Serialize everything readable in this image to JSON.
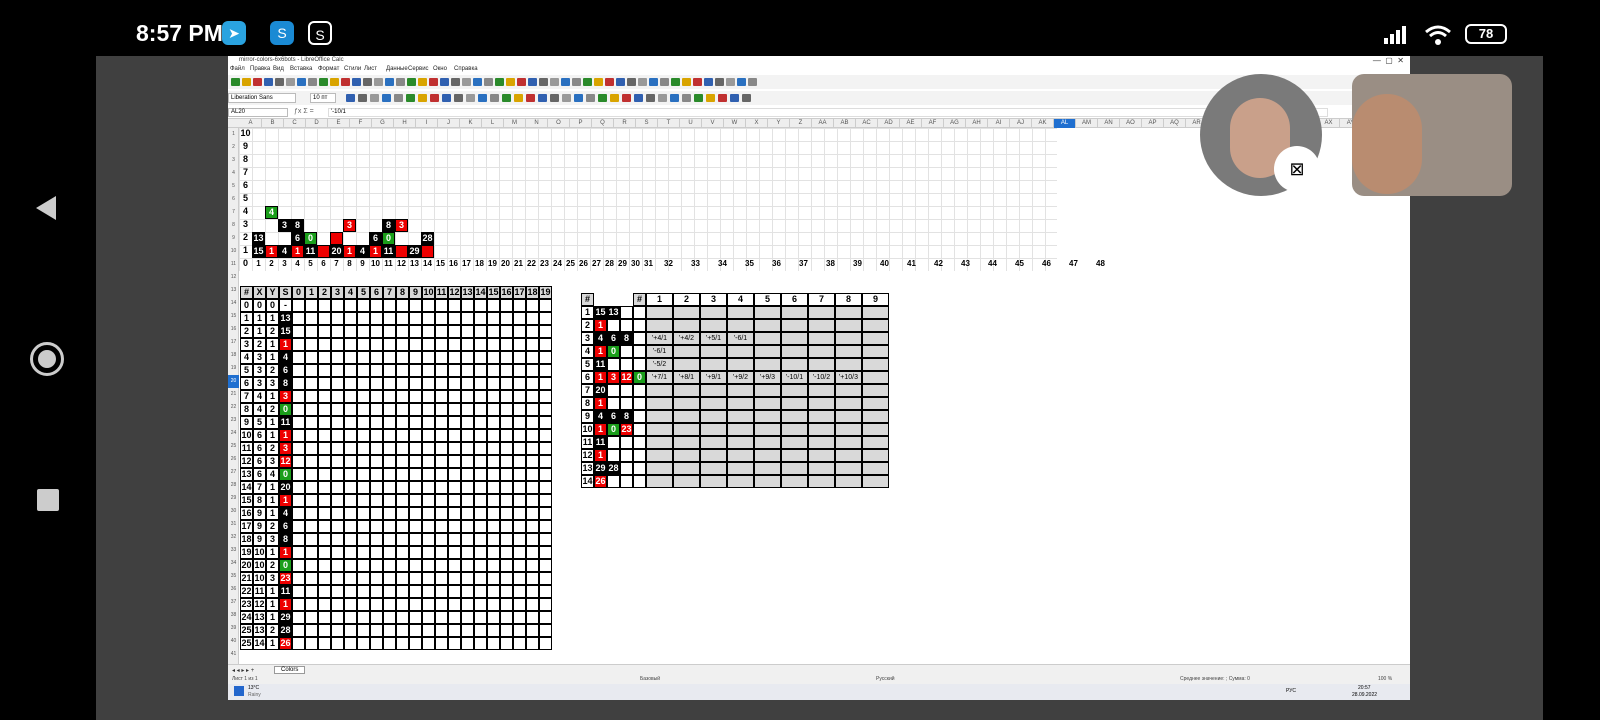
{
  "status": {
    "time": "8:57 PM",
    "battery": "78"
  },
  "window": {
    "title": "mirror-colors-6x6bots - LibreOffice Calc"
  },
  "menu": [
    "Файл",
    "Правка",
    "Вид",
    "Вставка",
    "Формат",
    "Стили",
    "Лист",
    "Данные",
    "Сервис",
    "Окно",
    "Справка"
  ],
  "font": {
    "name": "Liberation Sans",
    "size": "10 пт"
  },
  "formula": {
    "cellref": "AL20",
    "content": "'-10/1"
  },
  "sheet": {
    "tab": "Colors",
    "page": "Лист 1 из 1",
    "style": "Базовый",
    "lang": "Русский",
    "summary": "Среднее значение: ; Сумма: 0",
    "zoom": "100 %"
  },
  "taskbar": {
    "weather": "13°C",
    "cond": "Rainy",
    "lang": "РУС",
    "clock_time": "20:57",
    "clock_date": "28.09.2022"
  },
  "colletters": [
    "A",
    "B",
    "C",
    "D",
    "E",
    "F",
    "G",
    "H",
    "I",
    "J",
    "K",
    "L",
    "M",
    "N",
    "O",
    "P",
    "Q",
    "R",
    "S",
    "T",
    "U",
    "V",
    "W",
    "X",
    "Y",
    "Z",
    "AA",
    "AB",
    "AC",
    "AD",
    "AE",
    "AF",
    "AG",
    "AH",
    "AI",
    "AJ",
    "AK",
    "AL",
    "AM",
    "AN",
    "AO",
    "AP",
    "AQ",
    "AR",
    "AS",
    "AT",
    "AU",
    "AV",
    "AW",
    "AX",
    "AY",
    "AZ"
  ],
  "chart_left_labels": [
    "10",
    "9",
    "8",
    "7",
    "6",
    "5",
    "4",
    "3",
    "2",
    "1",
    "0"
  ],
  "chart_bottom": [
    "1",
    "2",
    "3",
    "4",
    "5",
    "6",
    "7",
    "8",
    "9",
    "10",
    "11",
    "12",
    "13",
    "14",
    "15",
    "16",
    "17",
    "18",
    "19",
    "20",
    "21",
    "22",
    "23",
    "24",
    "25",
    "26",
    "27",
    "28",
    "29",
    "30",
    "31",
    "32",
    "33",
    "34",
    "35",
    "36",
    "37",
    "38",
    "39",
    "40",
    "41",
    "42",
    "43",
    "44",
    "45",
    "46",
    "47",
    "48"
  ],
  "chart_cells": [
    {
      "row": 3,
      "col": 1,
      "v": "4",
      "c": "grn"
    },
    {
      "row": 4,
      "col": 2,
      "v": "3",
      "c": "blk"
    },
    {
      "row": 4,
      "col": 3,
      "v": "8",
      "c": "blk"
    },
    {
      "row": 4,
      "col": 7,
      "v": "3",
      "c": "red"
    },
    {
      "row": 4,
      "col": 10,
      "v": "8",
      "c": "blk"
    },
    {
      "row": 4,
      "col": 11,
      "v": "3",
      "c": "red"
    },
    {
      "row": 5,
      "col": 0,
      "v": "13",
      "c": "blk"
    },
    {
      "row": 5,
      "col": 3,
      "v": "6",
      "c": "blk"
    },
    {
      "row": 5,
      "col": 4,
      "v": "0",
      "c": "grn"
    },
    {
      "row": 5,
      "col": 6,
      "v": "",
      "c": "red"
    },
    {
      "row": 5,
      "col": 9,
      "v": "6",
      "c": "blk"
    },
    {
      "row": 5,
      "col": 10,
      "v": "0",
      "c": "grn"
    },
    {
      "row": 5,
      "col": 13,
      "v": "28",
      "c": "blk"
    },
    {
      "row": 6,
      "col": 0,
      "v": "15",
      "c": "blk"
    },
    {
      "row": 6,
      "col": 1,
      "v": "1",
      "c": "red"
    },
    {
      "row": 6,
      "col": 2,
      "v": "4",
      "c": "blk"
    },
    {
      "row": 6,
      "col": 3,
      "v": "1",
      "c": "red"
    },
    {
      "row": 6,
      "col": 4,
      "v": "11",
      "c": "blk"
    },
    {
      "row": 6,
      "col": 5,
      "v": "",
      "c": "red"
    },
    {
      "row": 6,
      "col": 6,
      "v": "20",
      "c": "blk"
    },
    {
      "row": 6,
      "col": 7,
      "v": "1",
      "c": "red"
    },
    {
      "row": 6,
      "col": 8,
      "v": "4",
      "c": "blk"
    },
    {
      "row": 6,
      "col": 9,
      "v": "1",
      "c": "red"
    },
    {
      "row": 6,
      "col": 10,
      "v": "11",
      "c": "blk"
    },
    {
      "row": 6,
      "col": 11,
      "v": "",
      "c": "red"
    },
    {
      "row": 6,
      "col": 12,
      "v": "29",
      "c": "blk"
    },
    {
      "row": 6,
      "col": 13,
      "v": "",
      "c": "red"
    }
  ],
  "table_headers": [
    "#",
    "X",
    "Y",
    "S",
    "0",
    "1",
    "2",
    "3",
    "4",
    "5",
    "6",
    "7",
    "8",
    "9",
    "10",
    "11",
    "12",
    "13",
    "14",
    "15",
    "16",
    "17",
    "18",
    "19"
  ],
  "table_rows": [
    [
      "0",
      "0",
      "0",
      "-",
      ""
    ],
    [
      "1",
      "1",
      "1",
      "13",
      "blk"
    ],
    [
      "2",
      "1",
      "2",
      "15",
      "blk"
    ],
    [
      "3",
      "2",
      "1",
      "1",
      "red"
    ],
    [
      "4",
      "3",
      "1",
      "4",
      "blk"
    ],
    [
      "5",
      "3",
      "2",
      "6",
      "blk"
    ],
    [
      "6",
      "3",
      "3",
      "8",
      "blk"
    ],
    [
      "7",
      "4",
      "1",
      "3",
      "red"
    ],
    [
      "8",
      "4",
      "2",
      "0",
      "grn"
    ],
    [
      "9",
      "5",
      "1",
      "11",
      "blk"
    ],
    [
      "10",
      "6",
      "1",
      "1",
      "red"
    ],
    [
      "11",
      "6",
      "2",
      "3",
      "red"
    ],
    [
      "12",
      "6",
      "3",
      "12",
      "red"
    ],
    [
      "13",
      "6",
      "4",
      "0",
      "grn"
    ],
    [
      "14",
      "7",
      "1",
      "20",
      "blk"
    ],
    [
      "15",
      "8",
      "1",
      "1",
      "red"
    ],
    [
      "16",
      "9",
      "1",
      "4",
      "blk"
    ],
    [
      "17",
      "9",
      "2",
      "6",
      "blk"
    ],
    [
      "18",
      "9",
      "3",
      "8",
      "blk"
    ],
    [
      "19",
      "10",
      "1",
      "1",
      "red"
    ],
    [
      "20",
      "10",
      "2",
      "0",
      "grn"
    ],
    [
      "21",
      "10",
      "3",
      "23",
      "red"
    ],
    [
      "22",
      "11",
      "1",
      "11",
      "blk"
    ],
    [
      "23",
      "12",
      "1",
      "1",
      "red"
    ],
    [
      "24",
      "13",
      "1",
      "29",
      "blk"
    ],
    [
      "25",
      "13",
      "2",
      "28",
      "blk"
    ],
    [
      "25",
      "14",
      "1",
      "26",
      "red"
    ]
  ],
  "right_headers": [
    "#",
    "#",
    "1",
    "2",
    "3",
    "4",
    "5",
    "6",
    "7",
    "8",
    "9"
  ],
  "right_rows": [
    {
      "n": "1",
      "cells": [
        [
          "15",
          "blk"
        ],
        [
          "13",
          "blk"
        ]
      ],
      "notes": []
    },
    {
      "n": "2",
      "cells": [
        [
          "1",
          "red"
        ]
      ],
      "notes": []
    },
    {
      "n": "3",
      "cells": [
        [
          "4",
          "blk"
        ],
        [
          "6",
          "blk"
        ],
        [
          "8",
          "blk"
        ]
      ],
      "notes": [
        "'+4/1",
        "'+4/2",
        "'+5/1",
        "'-6/1"
      ]
    },
    {
      "n": "4",
      "cells": [
        [
          "1",
          "red"
        ],
        [
          "0",
          "grn"
        ]
      ],
      "notes": [
        "'-6/1"
      ]
    },
    {
      "n": "5",
      "cells": [
        [
          "11",
          "blk"
        ]
      ],
      "notes": [
        "'-5/2"
      ]
    },
    {
      "n": "6",
      "cells": [
        [
          "1",
          "red"
        ],
        [
          "3",
          "red"
        ],
        [
          "12",
          "red"
        ],
        [
          "0",
          "grn"
        ]
      ],
      "notes": [
        "'+7/1",
        "'+8/1",
        "'+9/1",
        "'+9/2",
        "'+9/3",
        "'-10/1",
        "'-10/2",
        "'+10/3"
      ]
    },
    {
      "n": "7",
      "cells": [
        [
          "20",
          "blk"
        ]
      ],
      "notes": []
    },
    {
      "n": "8",
      "cells": [
        [
          "1",
          "red"
        ]
      ],
      "notes": []
    },
    {
      "n": "9",
      "cells": [
        [
          "4",
          "blk"
        ],
        [
          "6",
          "blk"
        ],
        [
          "8",
          "blk"
        ]
      ],
      "notes": []
    },
    {
      "n": "10",
      "cells": [
        [
          "1",
          "red"
        ],
        [
          "0",
          "grn"
        ],
        [
          "23",
          "red"
        ]
      ],
      "notes": []
    },
    {
      "n": "11",
      "cells": [
        [
          "11",
          "blk"
        ]
      ],
      "notes": []
    },
    {
      "n": "12",
      "cells": [
        [
          "1",
          "red"
        ]
      ],
      "notes": []
    },
    {
      "n": "13",
      "cells": [
        [
          "29",
          "blk"
        ],
        [
          "28",
          "blk"
        ]
      ],
      "notes": []
    },
    {
      "n": "14",
      "cells": [
        [
          "26",
          "red"
        ]
      ],
      "notes": []
    }
  ]
}
